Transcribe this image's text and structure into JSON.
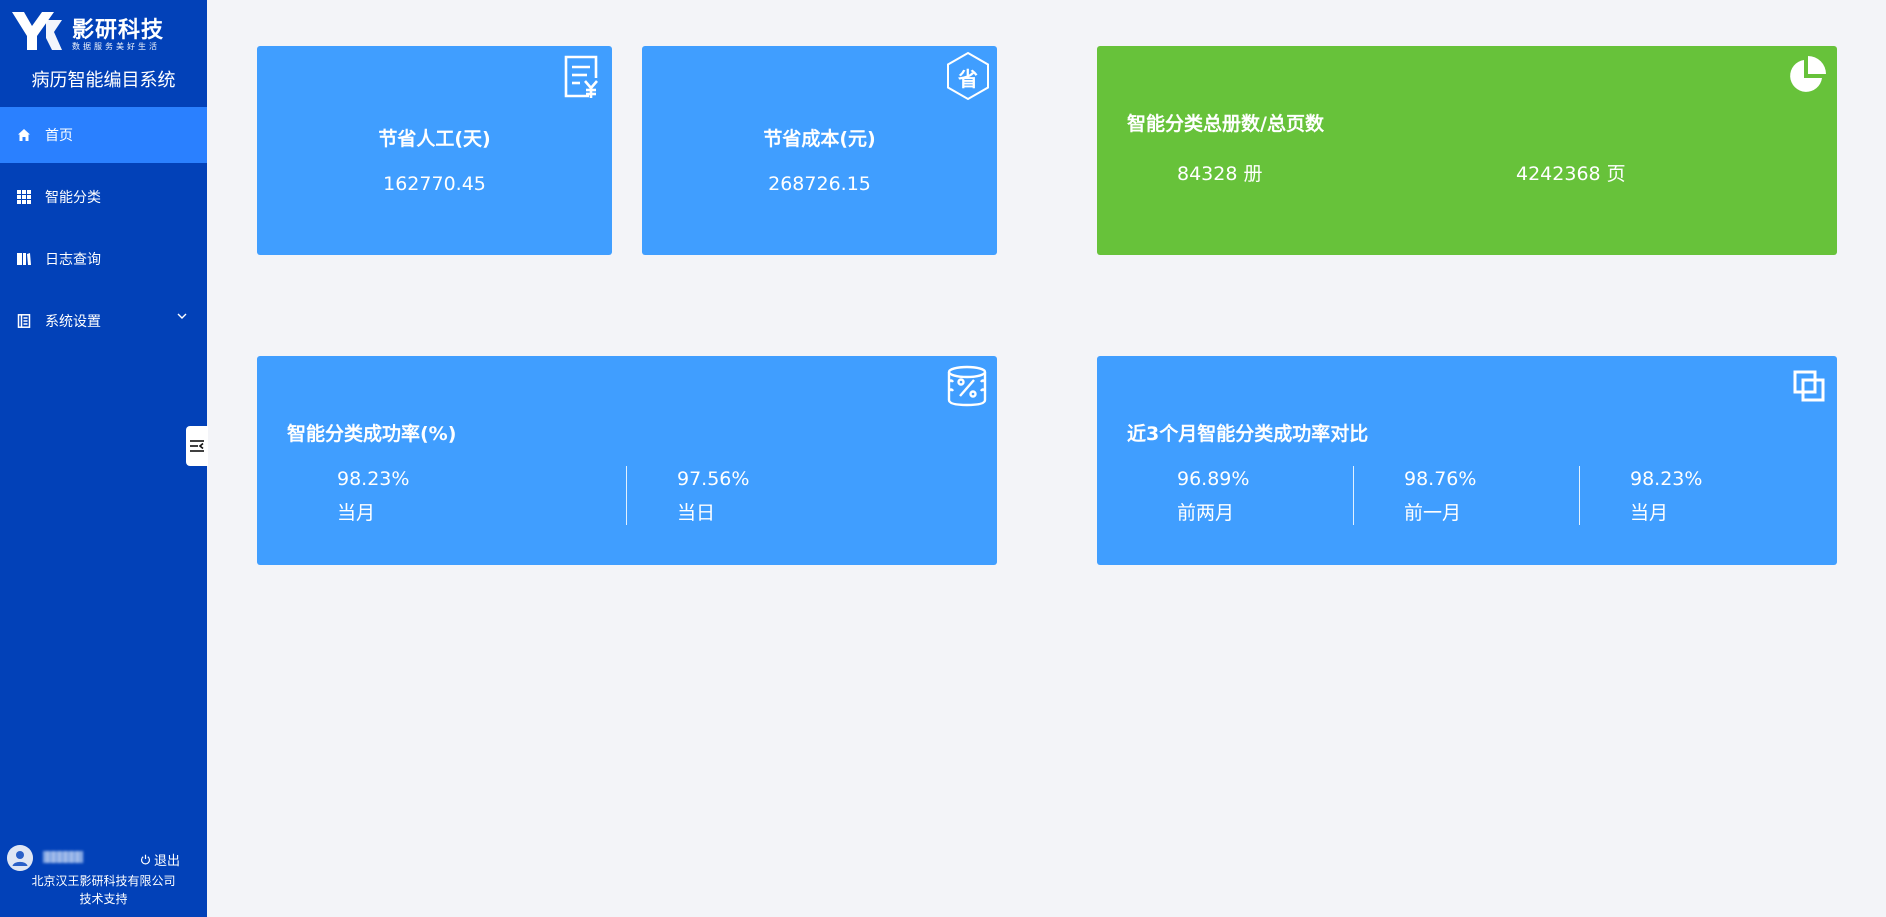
{
  "brand": {
    "name": "影研科技",
    "slogan": "数据服务美好生活",
    "system_title": "病历智能编目系统"
  },
  "nav": [
    {
      "label": "首页",
      "icon": "home-icon",
      "active": true
    },
    {
      "label": "智能分类",
      "icon": "grid-icon",
      "active": false
    },
    {
      "label": "日志查询",
      "icon": "book-icon",
      "active": false
    },
    {
      "label": "系统设置",
      "icon": "document-icon",
      "active": false,
      "expandable": true
    }
  ],
  "footer": {
    "logout_label": "退出",
    "company": "北京汉王影研科技有限公司",
    "support": "技术支持"
  },
  "cards": {
    "labor": {
      "title": "节省人工(天)",
      "value": "162770.45"
    },
    "cost": {
      "title": "节省成本(元)",
      "value": "268726.15",
      "icon_char": "省"
    },
    "totals": {
      "title": "智能分类总册数/总页数",
      "volumes": "84328 册",
      "pages": "4242368 页"
    },
    "success_rate": {
      "title": "智能分类成功率(%)",
      "items": [
        {
          "value": "98.23%",
          "label": "当月"
        },
        {
          "value": "97.56%",
          "label": "当日"
        }
      ]
    },
    "compare": {
      "title": "近3个月智能分类成功率对比",
      "items": [
        {
          "value": "96.89%",
          "label": "前两月"
        },
        {
          "value": "98.76%",
          "label": "前一月"
        },
        {
          "value": "98.23%",
          "label": "当月"
        }
      ]
    }
  },
  "colors": {
    "sidebar": "#0241b8",
    "nav_active": "#2a80ff",
    "card_blue": "#409eff",
    "card_green": "#67c23a",
    "page_bg": "#f3f4f8"
  }
}
